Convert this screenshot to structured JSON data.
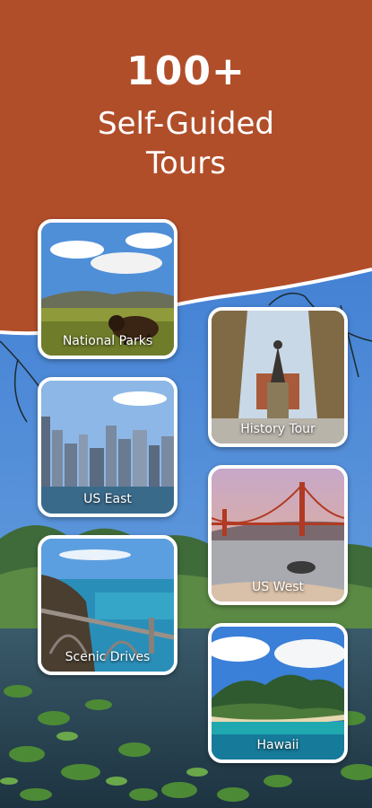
{
  "header": {
    "count": "100+",
    "subtitle_line1": "Self-Guided",
    "subtitle_line2": "Tours"
  },
  "colors": {
    "brand": "#b14e2a",
    "card_border": "#ffffff",
    "text": "#ffffff"
  },
  "tours": [
    {
      "label": "National Parks",
      "icon": "bison-prairie-image"
    },
    {
      "label": "History Tour",
      "icon": "statue-plaza-image"
    },
    {
      "label": "US East",
      "icon": "city-skyline-image"
    },
    {
      "label": "US West",
      "icon": "golden-gate-image"
    },
    {
      "label": "Scenic Drives",
      "icon": "coastal-bridge-image"
    },
    {
      "label": "Hawaii",
      "icon": "island-coast-image"
    }
  ]
}
